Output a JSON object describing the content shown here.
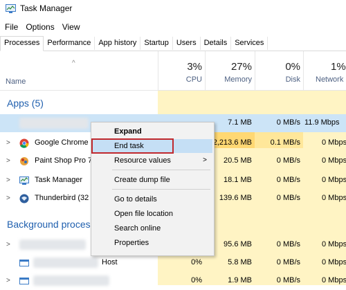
{
  "window": {
    "title": "Task Manager"
  },
  "menu": [
    "File",
    "Options",
    "View"
  ],
  "tabs": [
    "Processes",
    "Performance",
    "App history",
    "Startup",
    "Users",
    "Details",
    "Services"
  ],
  "header": {
    "name": "Name",
    "columns": [
      {
        "pct": "3%",
        "label": "CPU"
      },
      {
        "pct": "27%",
        "label": "Memory"
      },
      {
        "pct": "0%",
        "label": "Disk"
      },
      {
        "pct": "1%",
        "label": "Network"
      }
    ]
  },
  "groups": {
    "apps": "Apps (5)",
    "background": "Background processes"
  },
  "rows": [
    {
      "name": "",
      "cpu": "",
      "memory": "7.1 MB",
      "disk": "0 MB/s",
      "network": "11.9 Mbps"
    },
    {
      "name": "Google Chrome",
      "cpu": "",
      "memory": "2,213.6 MB",
      "disk": "0.1 MB/s",
      "network": "0 Mbps"
    },
    {
      "name": "Paint Shop Pro 7",
      "cpu": "",
      "memory": "20.5 MB",
      "disk": "0 MB/s",
      "network": "0 Mbps"
    },
    {
      "name": "Task Manager",
      "cpu": "",
      "memory": "18.1 MB",
      "disk": "0 MB/s",
      "network": "0 Mbps"
    },
    {
      "name": "Thunderbird (32",
      "cpu": "",
      "memory": "139.6 MB",
      "disk": "0 MB/s",
      "network": "0 Mbps"
    }
  ],
  "bg_rows": [
    {
      "name": "",
      "cpu": "",
      "memory": "95.6 MB",
      "disk": "0 MB/s",
      "network": "0 Mbps"
    },
    {
      "name": "Host",
      "cpu": "0%",
      "memory": "5.8 MB",
      "disk": "0 MB/s",
      "network": "0 Mbps"
    },
    {
      "name": "",
      "cpu": "0%",
      "memory": "1.9 MB",
      "disk": "0 MB/s",
      "network": "0 Mbps"
    }
  ],
  "context_menu": {
    "expand": "Expand",
    "end_task": "End task",
    "resource_values": "Resource values",
    "create_dump": "Create dump file",
    "go_to_details": "Go to details",
    "open_file_location": "Open file location",
    "search_online": "Search online",
    "properties": "Properties"
  },
  "colors": {
    "shade": "#fff4c4",
    "accent": "#1f5fae",
    "highlight_box": "#c0282d",
    "selected_row": "#cce4f7"
  },
  "icons": [
    "task-manager-icon",
    "chrome-icon",
    "paint-shop-pro-icon",
    "thunderbird-icon",
    "chevron-right-icon",
    "sort-up-arrow-icon"
  ]
}
